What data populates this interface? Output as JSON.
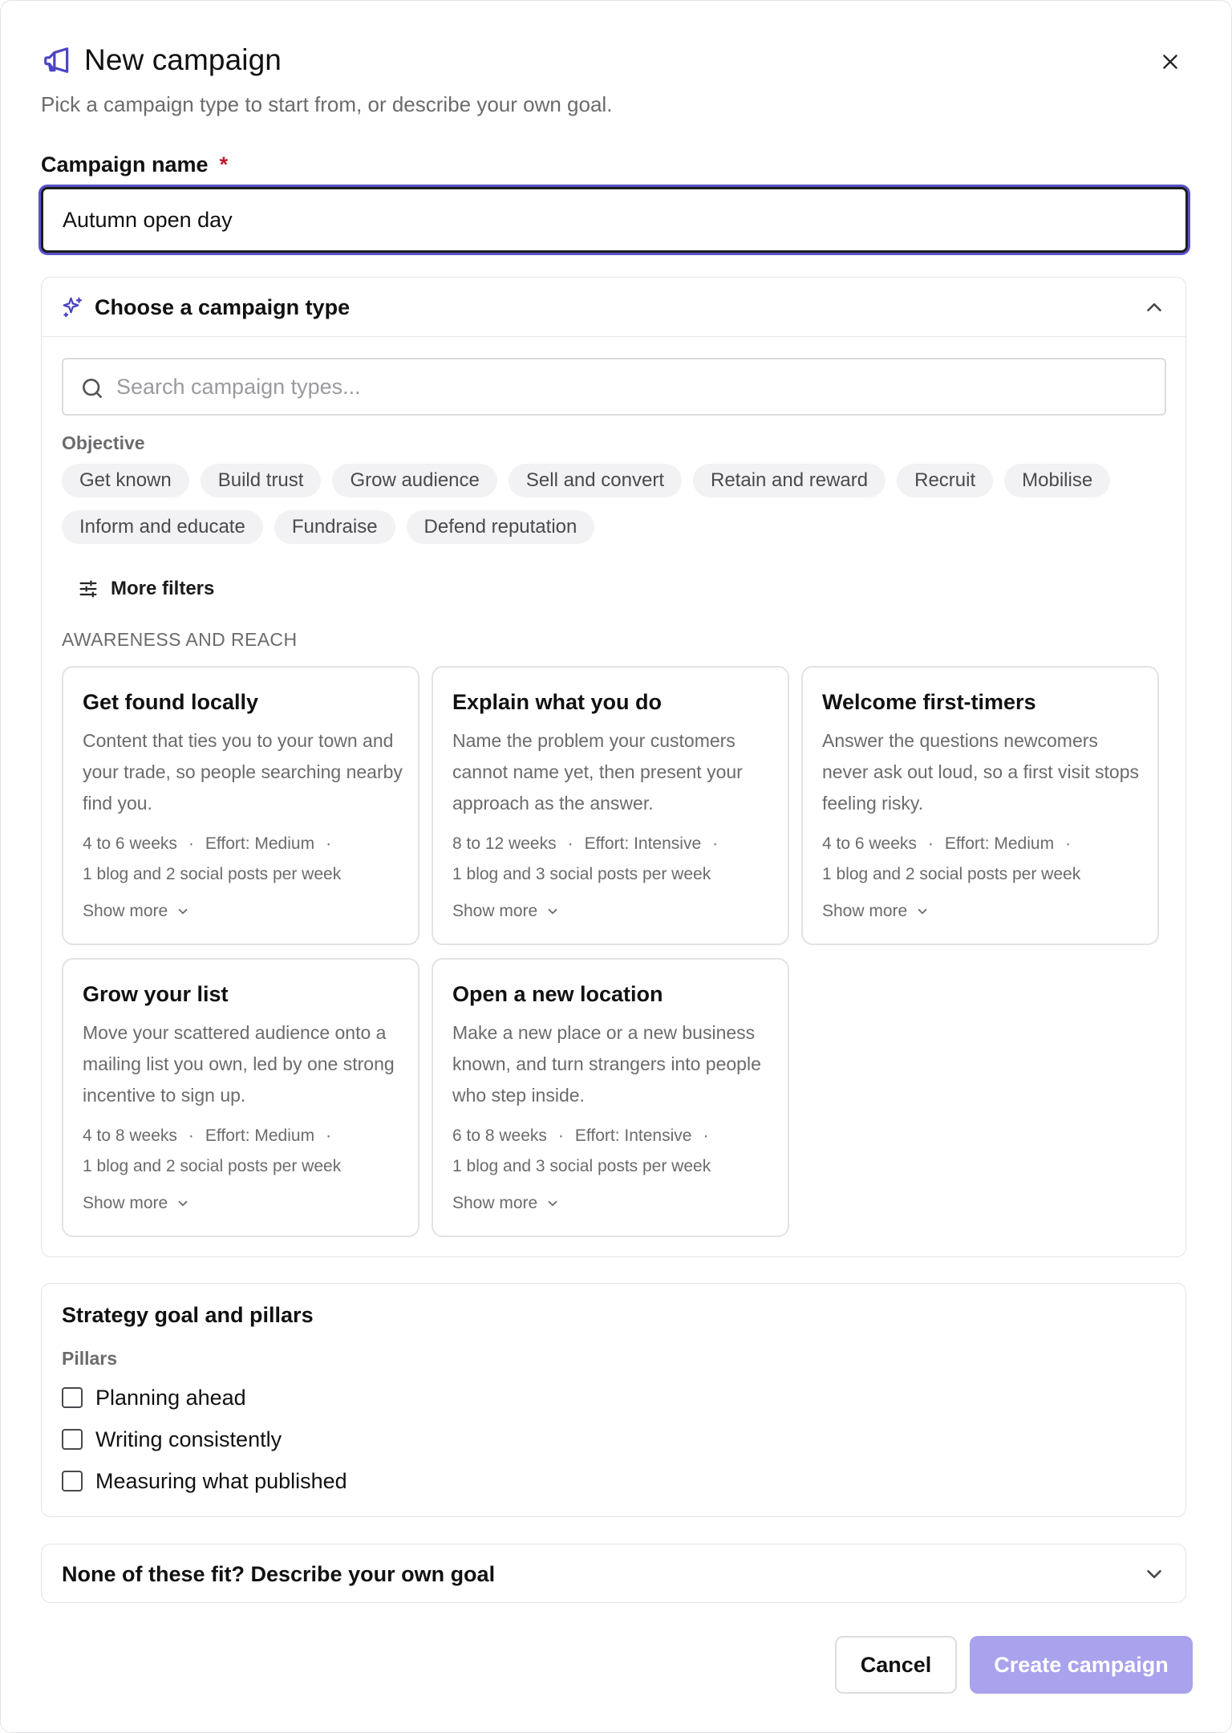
{
  "dialog": {
    "title": "New campaign",
    "subtitle": "Pick a campaign type to start from, or describe your own goal.",
    "accent_color": "#4b44c4"
  },
  "campaign_name": {
    "label": "Campaign name",
    "required_mark": "*",
    "value": "Autumn open day"
  },
  "campaign_type": {
    "header": "Choose a campaign type",
    "expanded": true,
    "search_placeholder": "Search campaign types...",
    "objective_label": "Objective",
    "objectives": [
      "Get known",
      "Build trust",
      "Grow audience",
      "Sell and convert",
      "Retain and reward",
      "Recruit",
      "Mobilise",
      "Inform and educate",
      "Fundraise",
      "Defend reputation"
    ],
    "more_filters_label": "More filters",
    "section_title": "AWARENESS AND REACH",
    "cards": [
      {
        "title": "Get found locally",
        "description": "Content that ties you to your town and your trade, so people searching nearby find you.",
        "duration": "4 to 6 weeks",
        "effort": "Effort: Medium",
        "cadence": "1 blog and 2 social posts per week",
        "show_more": "Show more"
      },
      {
        "title": "Explain what you do",
        "description": "Name the problem your customers cannot name yet, then present your approach as the answer.",
        "duration": "8 to 12 weeks",
        "effort": "Effort: Intensive",
        "cadence": "1 blog and 3 social posts per week",
        "show_more": "Show more"
      },
      {
        "title": "Welcome first-timers",
        "description": "Answer the questions newcomers never ask out loud, so a first visit stops feeling risky.",
        "duration": "4 to 6 weeks",
        "effort": "Effort: Medium",
        "cadence": "1 blog and 2 social posts per week",
        "show_more": "Show more"
      },
      {
        "title": "Grow your list",
        "description": "Move your scattered audience onto a mailing list you own, led by one strong incentive to sign up.",
        "duration": "4 to 8 weeks",
        "effort": "Effort: Medium",
        "cadence": "1 blog and 2 social posts per week",
        "show_more": "Show more"
      },
      {
        "title": "Open a new location",
        "description": "Make a new place or a new business known, and turn strangers into people who step inside.",
        "duration": "6 to 8 weeks",
        "effort": "Effort: Intensive",
        "cadence": "1 blog and 3 social posts per week",
        "show_more": "Show more"
      }
    ]
  },
  "strategy": {
    "title": "Strategy goal and pillars",
    "pillars_label": "Pillars",
    "pillars": [
      {
        "label": "Planning ahead",
        "checked": false
      },
      {
        "label": "Writing consistently",
        "checked": false
      },
      {
        "label": "Measuring what published",
        "checked": false
      }
    ]
  },
  "own_goal": {
    "label": "None of these fit? Describe your own goal",
    "expanded": false
  },
  "footer": {
    "cancel_label": "Cancel",
    "create_label": "Create campaign",
    "create_enabled": false,
    "create_color": "#a9a2ec"
  },
  "icons": {
    "title": "megaphone-icon",
    "close": "close-icon",
    "campaign_type": "sparkle-icon",
    "search": "search-icon",
    "filters": "sliders-icon",
    "collapse": "chevron-up-icon",
    "expand": "chevron-down-icon"
  }
}
